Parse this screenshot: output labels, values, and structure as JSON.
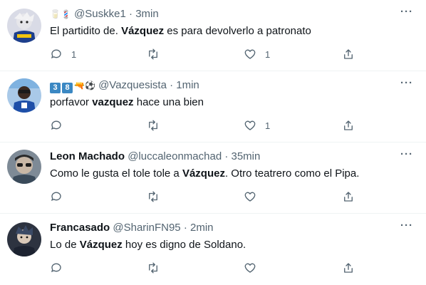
{
  "tweets": [
    {
      "name": "",
      "badges": [
        "🥛",
        "💈"
      ],
      "handle": "@Suskke1",
      "sep": "·",
      "time": "3min",
      "text_parts": [
        "El partidito de. ",
        "Vázquez",
        " es para devolverlo a patronato"
      ],
      "reply_count": "1",
      "retweet_count": "",
      "like_count": "1"
    },
    {
      "name": "",
      "badges": [
        "3",
        "8",
        "🔫",
        "⚽"
      ],
      "handle": "@Vazquesista",
      "sep": "·",
      "time": "1min",
      "text_parts": [
        "porfavor ",
        "vazquez",
        " hace una bien"
      ],
      "reply_count": "",
      "retweet_count": "",
      "like_count": "1"
    },
    {
      "name": "Leon Machado",
      "badges": [],
      "handle": "@luccaleonmachad",
      "sep": "·",
      "time": "35min",
      "text_parts": [
        "Como le gusta el tole tole a ",
        "Vázquez",
        ". Otro teatrero como el Pipa."
      ],
      "reply_count": "",
      "retweet_count": "",
      "like_count": ""
    },
    {
      "name": "Francasado",
      "badges": [],
      "handle": "@SharinFN95",
      "sep": "·",
      "time": "2min",
      "text_parts": [
        "Lo de ",
        "Vázquez",
        " hoy es digno de Soldano."
      ],
      "reply_count": "",
      "retweet_count": "",
      "like_count": ""
    }
  ],
  "more_label": "···",
  "icons": {
    "reply": "reply-icon",
    "retweet": "retweet-icon",
    "like": "like-icon",
    "share": "share-icon",
    "more": "more-icon"
  },
  "colors": {
    "text_primary": "#0f1419",
    "text_secondary": "#536471",
    "divider": "#eff3f4",
    "keycap_blue": "#3b88c3"
  }
}
